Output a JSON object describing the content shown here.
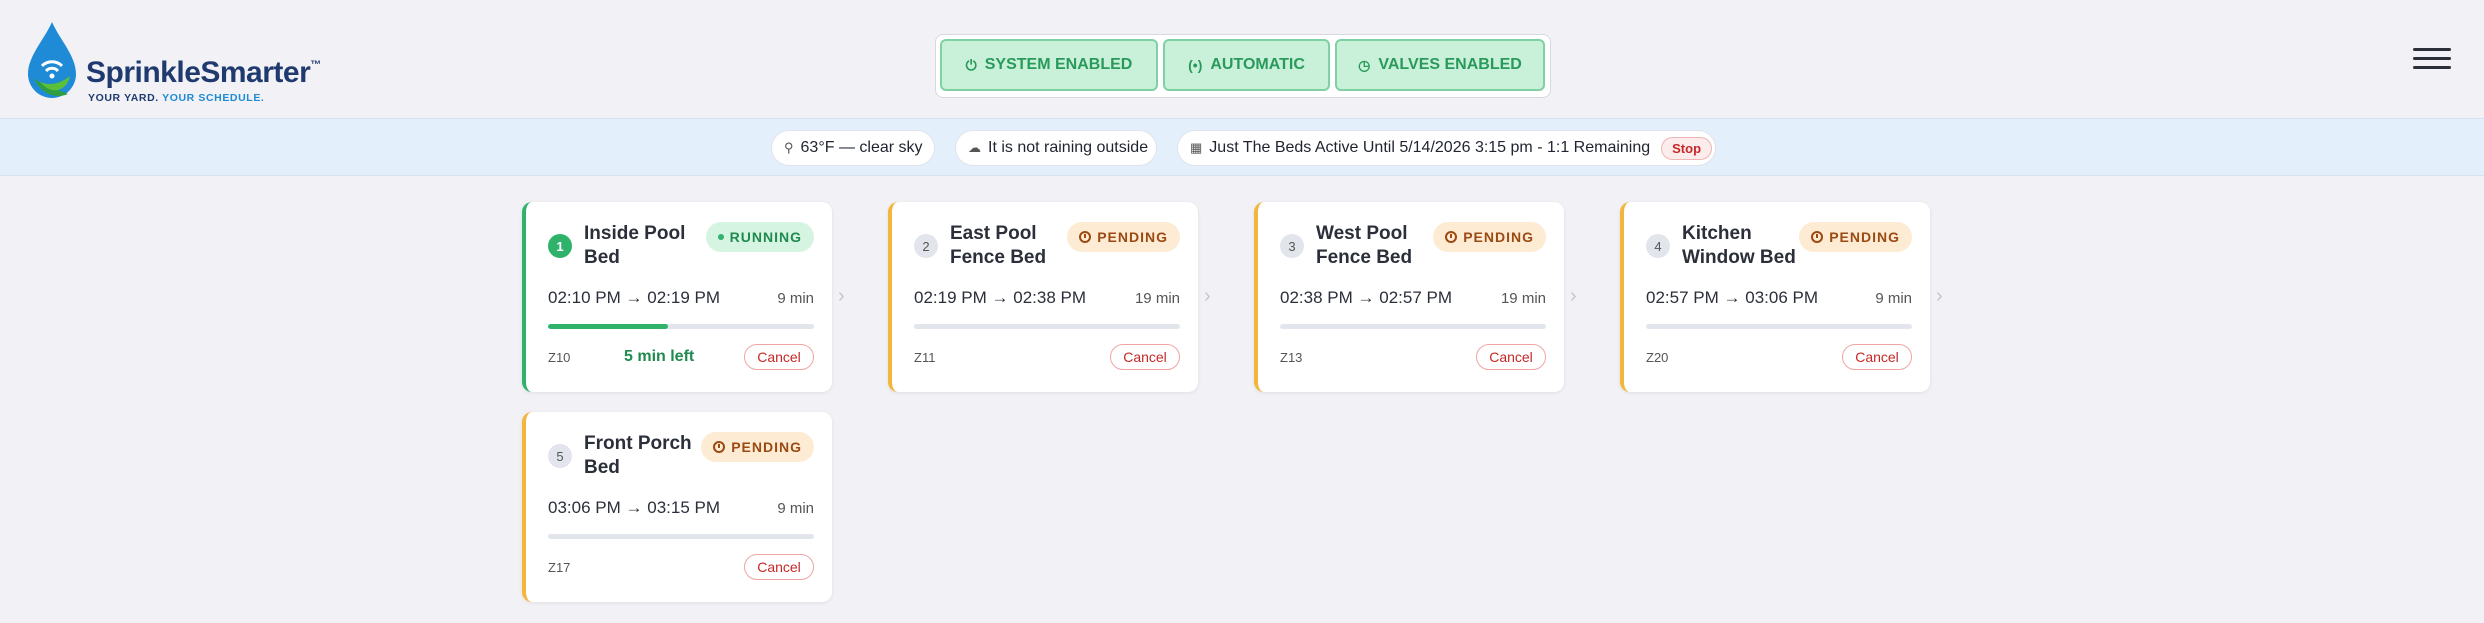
{
  "header": {
    "brand_name": "SprinkleSmarter",
    "brand_mark": "™",
    "tagline_part1": "YOUR YARD.",
    "tagline_part2": "YOUR SCHEDULE.",
    "status_buttons": [
      {
        "label": "SYSTEM ENABLED",
        "icon": "power-icon"
      },
      {
        "label": "AUTOMATIC",
        "icon": "auto-icon"
      },
      {
        "label": "VALVES ENABLED",
        "icon": "clock-icon"
      }
    ],
    "menu_icon": "hamburger-menu-icon"
  },
  "colors": {
    "brand_navy": "#1f3a6e",
    "brand_blue": "#1f8ad6",
    "running_green": "#2fb36a",
    "pending_orange": "#f2b63c",
    "danger_red": "#c62828",
    "infobar_bg": "#e4effc"
  },
  "infobar": {
    "weather": "63°F — clear sky",
    "rain": "It is not raining outside",
    "active_schedule": "Just The Beds Active Until 5/14/2026 3:15 pm - 1:1 Remaining",
    "stop_label": "Stop"
  },
  "zones": [
    {
      "num": "1",
      "name": "Inside Pool Bed",
      "status": "RUNNING",
      "start": "02:10 PM",
      "end": "02:19 PM",
      "duration": "9 min",
      "zone": "Z10",
      "remaining": "5 min left",
      "progress": 0.45,
      "cancel": "Cancel"
    },
    {
      "num": "2",
      "name": "East Pool Fence Bed",
      "status": "PENDING",
      "start": "02:19 PM",
      "end": "02:38 PM",
      "duration": "19 min",
      "zone": "Z11",
      "progress": 0,
      "cancel": "Cancel"
    },
    {
      "num": "3",
      "name": "West Pool Fence Bed",
      "status": "PENDING",
      "start": "02:38 PM",
      "end": "02:57 PM",
      "duration": "19 min",
      "zone": "Z13",
      "progress": 0,
      "cancel": "Cancel"
    },
    {
      "num": "4",
      "name": "Kitchen Window Bed",
      "status": "PENDING",
      "start": "02:57 PM",
      "end": "03:06 PM",
      "duration": "9 min",
      "zone": "Z20",
      "progress": 0,
      "cancel": "Cancel"
    },
    {
      "num": "5",
      "name": "Front Porch Bed",
      "status": "PENDING",
      "start": "03:06 PM",
      "end": "03:15 PM",
      "duration": "9 min",
      "zone": "Z17",
      "progress": 0,
      "cancel": "Cancel"
    }
  ],
  "arrow_glyph": "→",
  "next_glyph": "›"
}
